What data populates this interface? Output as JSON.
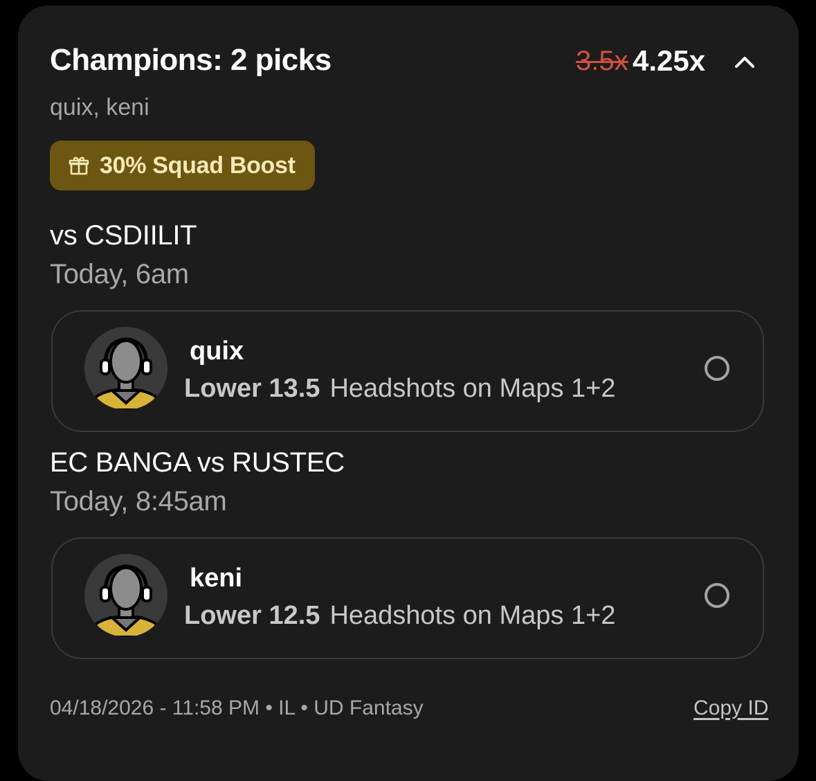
{
  "header": {
    "title": "Champions: 2 picks",
    "old_multiplier": "3.5x",
    "new_multiplier": "4.25x",
    "collapse_icon": "chevron-up-icon"
  },
  "subtitle": "quix, keni",
  "boost": {
    "icon": "gift-icon",
    "label": "30% Squad Boost",
    "color": "#6d5512"
  },
  "matches": [
    {
      "teams": " vs CSDIILIT",
      "time": "Today, 6am",
      "pick": {
        "player": "quix",
        "direction": "Lower",
        "value": "13.5",
        "stat": "Headshots on Maps 1+2",
        "avatar_icon": "player-silhouette-icon",
        "status_icon": "radio-empty-icon"
      }
    },
    {
      "teams": "EC BANGA vs RUSTEC",
      "time": "Today, 8:45am",
      "pick": {
        "player": "keni",
        "direction": "Lower",
        "value": "12.5",
        "stat": "Headshots on Maps 1+2",
        "avatar_icon": "player-silhouette-icon",
        "status_icon": "radio-empty-icon"
      }
    }
  ],
  "footer": {
    "meta": "04/18/2026 - 11:58 PM • IL • UD Fantasy",
    "copy_label": "Copy ID"
  },
  "colors": {
    "background": "#1c1c1c",
    "strike_red": "#d0503f",
    "boost_text": "#f6e9b8",
    "jersey_yellow": "#d8b33a"
  }
}
